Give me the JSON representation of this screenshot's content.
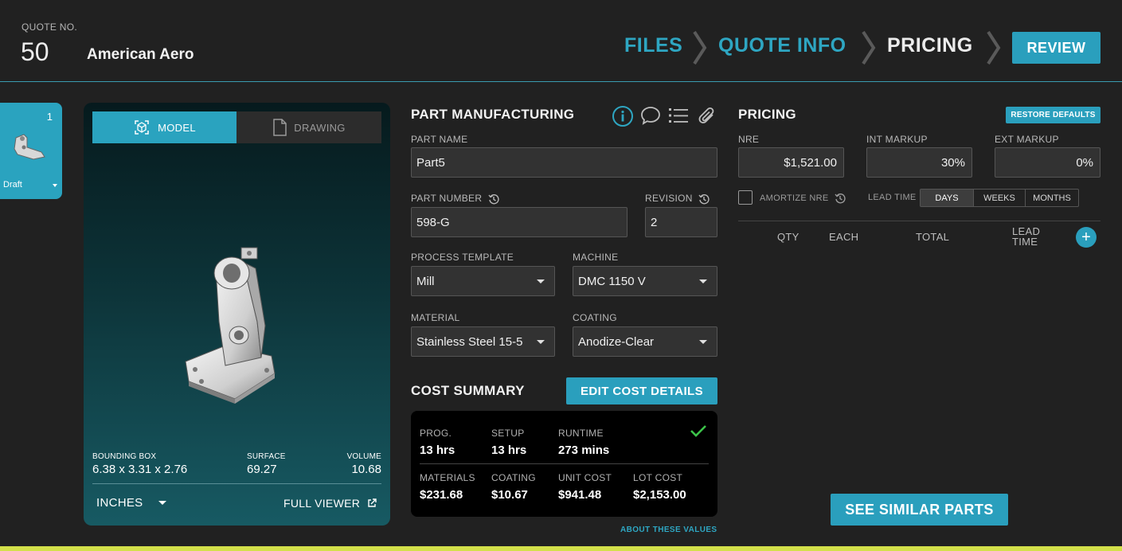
{
  "header": {
    "quote_label": "QUOTE NO.",
    "quote_number": "50",
    "company": "American Aero",
    "steps": [
      {
        "label": "FILES",
        "state": "done"
      },
      {
        "label": "QUOTE INFO",
        "state": "done"
      },
      {
        "label": "PRICING",
        "state": "current"
      }
    ],
    "review_label": "REVIEW"
  },
  "part_card": {
    "number": "1",
    "status": "Draft"
  },
  "viewer": {
    "tab_model": "MODEL",
    "tab_drawing": "DRAWING",
    "bounding_box_label": "BOUNDING BOX",
    "bounding_box_value": "6.38 x 3.31 x 2.76",
    "surface_label": "SURFACE",
    "surface_value": "69.27",
    "volume_label": "VOLUME",
    "volume_value": "10.68",
    "units": "INCHES",
    "full_viewer": "FULL VIEWER"
  },
  "manufacturing": {
    "title": "PART MANUFACTURING",
    "part_name_label": "PART NAME",
    "part_name": "Part5",
    "part_number_label": "PART NUMBER",
    "part_number": "598-G",
    "revision_label": "REVISION",
    "revision": "2",
    "process_template_label": "PROCESS TEMPLATE",
    "process_template": "Mill",
    "machine_label": "MACHINE",
    "machine": "DMC 1150 V",
    "material_label": "MATERIAL",
    "material": "Stainless Steel 15-5",
    "coating_label": "COATING",
    "coating": "Anodize-Clear"
  },
  "cost_summary": {
    "title": "COST SUMMARY",
    "edit_label": "EDIT COST DETAILS",
    "prog_label": "PROG.",
    "prog": "13 hrs",
    "setup_label": "SETUP",
    "setup": "13 hrs",
    "runtime_label": "RUNTIME",
    "runtime": "273 mins",
    "materials_label": "MATERIALS",
    "materials": "$231.68",
    "coating_label": "COATING",
    "coating": "$10.67",
    "unit_cost_label": "UNIT COST",
    "unit_cost": "$941.48",
    "lot_cost_label": "LOT COST",
    "lot_cost": "$2,153.00",
    "about": "ABOUT THESE VALUES"
  },
  "pricing": {
    "title": "PRICING",
    "restore_label": "RESTORE DEFAULTS",
    "nre_label": "NRE",
    "nre": "$1,521.00",
    "int_markup_label": "INT MARKUP",
    "int_markup": "30%",
    "ext_markup_label": "EXT MARKUP",
    "ext_markup": "0%",
    "amortize_label": "AMORTIZE NRE",
    "amortize_checked": false,
    "lead_time_label": "LEAD TIME",
    "lead_units": [
      "DAYS",
      "WEEKS",
      "MONTHS"
    ],
    "lead_unit_selected": "DAYS",
    "columns": [
      "QTY",
      "EACH",
      "TOTAL",
      "LEAD",
      "TIME"
    ],
    "similar_label": "SEE SIMILAR PARTS"
  },
  "colors": {
    "accent": "#2a9fbd",
    "background": "#212121",
    "bottom_bar": "#d3e04a",
    "check": "#3cc44a"
  }
}
